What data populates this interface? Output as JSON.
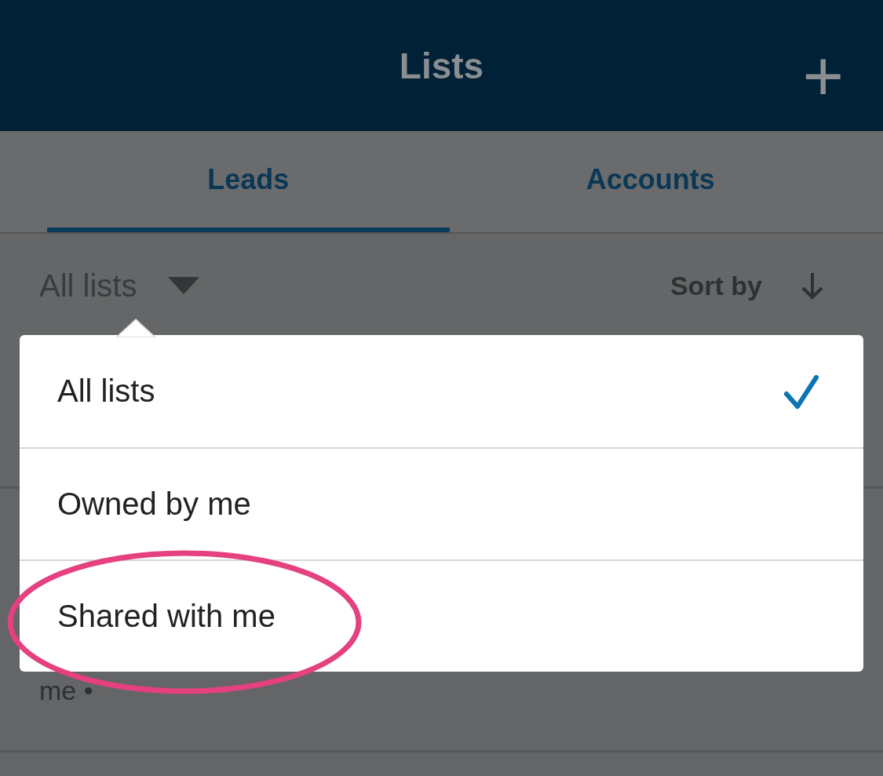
{
  "header": {
    "title": "Lists",
    "add_icon": "+"
  },
  "tabs": [
    {
      "label": "Leads",
      "selected": true
    },
    {
      "label": "Accounts",
      "selected": false
    }
  ],
  "filter": {
    "label": "All lists",
    "sort_label": "Sort by"
  },
  "background_row": {
    "meta": "me •"
  },
  "menu": {
    "items": [
      {
        "label": "All lists",
        "checked": true
      },
      {
        "label": "Owned by me",
        "checked": false
      },
      {
        "label": "Shared with me",
        "checked": false
      }
    ]
  },
  "annotation": {
    "kind": "ellipse"
  }
}
